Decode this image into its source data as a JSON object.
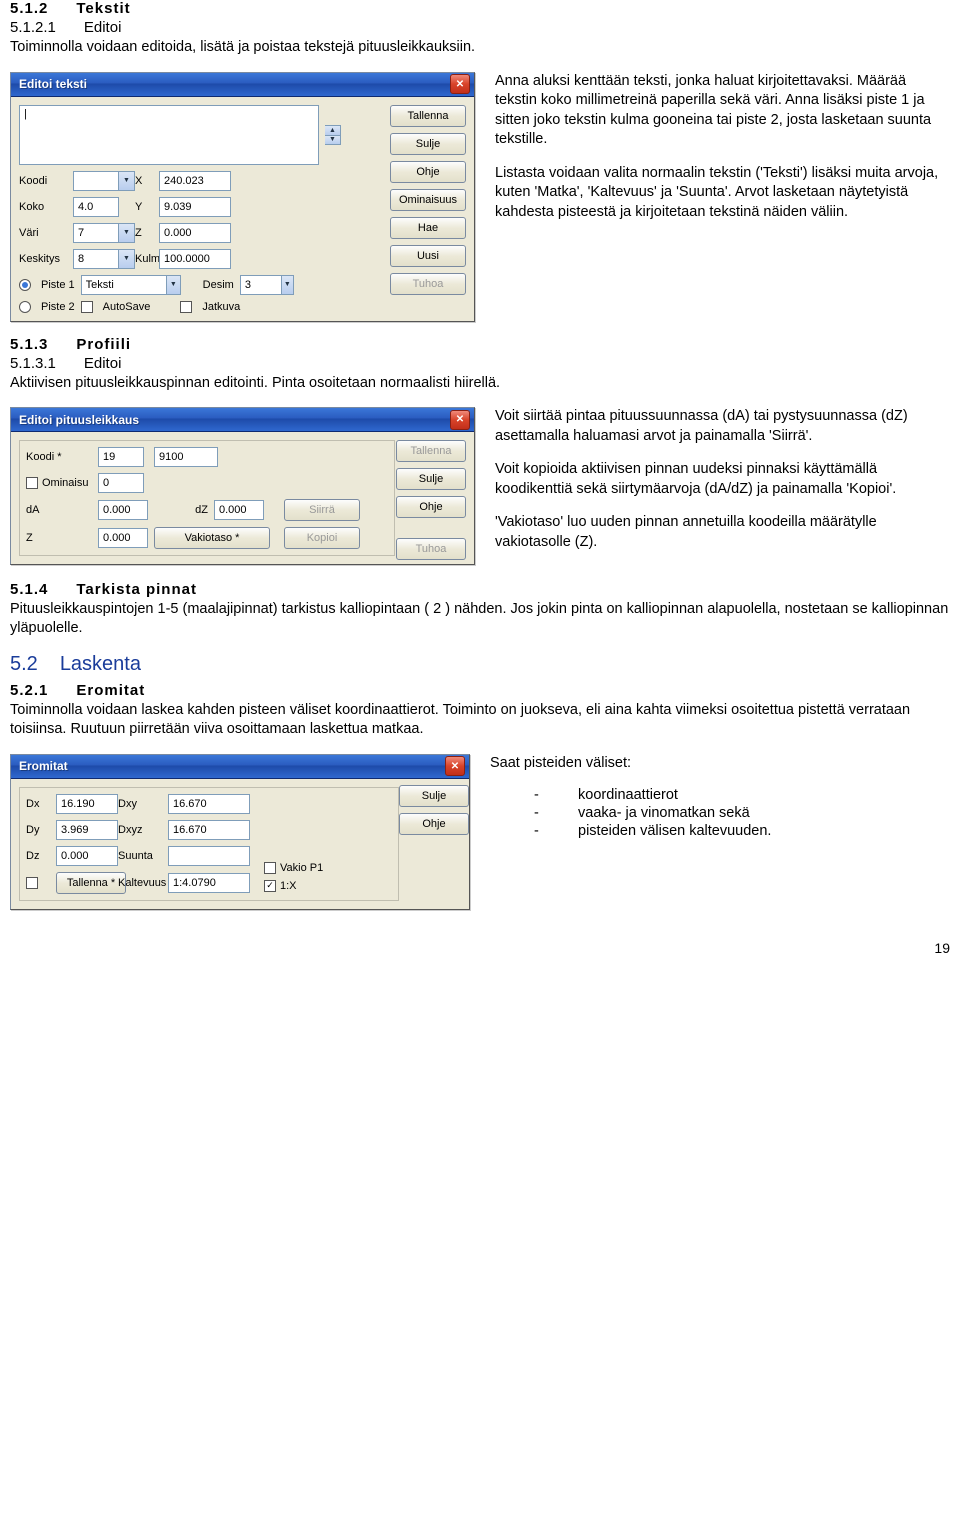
{
  "doc": {
    "s512_num": "5.1.2",
    "s512_title": "Tekstit",
    "s5121_num": "5.1.2.1",
    "s5121_title": "Editoi",
    "s5121_desc": "Toiminnolla voidaan editoida, lisätä ja poistaa tekstejä pituusleikkauksiin.",
    "s5121_p1": "Anna aluksi kenttään teksti, jonka haluat kirjoitettavaksi. Määrää tekstin koko millimetreinä paperilla sekä väri. Anna lisäksi piste 1 ja sitten joko tekstin kulma gooneina tai piste 2, josta lasketaan suunta tekstille.",
    "s5121_p2": "Listasta voidaan valita normaalin tekstin ('Teksti') lisäksi muita arvoja, kuten 'Matka', 'Kaltevuus' ja 'Suunta'. Arvot lasketaan näytetyistä kahdesta pisteestä ja kirjoitetaan tekstinä näiden väliin.",
    "s513_num": "5.1.3",
    "s513_title": "Profiili",
    "s5131_num": "5.1.3.1",
    "s5131_title": "Editoi",
    "s5131_desc": "Aktiivisen pituusleikkauspinnan editointi. Pinta osoitetaan normaalisti hiirellä.",
    "s5131_p1": "Voit siirtää pintaa pituussuunnassa (dA) tai pystysuunnassa (dZ) asettamalla haluamasi arvot ja painamalla 'Siirrä'.",
    "s5131_p2": "Voit kopioida aktiivisen pinnan uudeksi pinnaksi käyttämällä koodikenttiä sekä siirtymäarvoja (dA/dZ) ja painamalla 'Kopioi'.",
    "s5131_p3": "'Vakiotaso' luo uuden pinnan annetuilla koodeilla määrätylle vakiotasolle (Z).",
    "s514_num": "5.1.4",
    "s514_title": "Tarkista pinnat",
    "s514_desc": "Pituusleikkauspintojen 1-5 (maalajipinnat) tarkistus kalliopintaan ( 2 ) nähden. Jos jokin pinta on kalliopinnan alapuolella, nostetaan se kalliopinnan yläpuolelle.",
    "s52_num": "5.2",
    "s52_title": "Laskenta",
    "s521_num": "5.2.1",
    "s521_title": "Eromitat",
    "s521_desc": "Toiminnolla voidaan laskea kahden pisteen väliset koordinaattierot. Toiminto on juokseva, eli aina kahta viimeksi osoitettua pistettä verrataan toisiinsa. Ruutuun piirretään viiva osoittamaan laskettua matkaa.",
    "s521_p1": "Saat pisteiden väliset:",
    "s521_li1": "koordinaattierot",
    "s521_li2": "vaaka- ja vinomatkan sekä",
    "s521_li3": "pisteiden välisen kaltevuuden.",
    "page": "19"
  },
  "dlg1": {
    "title": "Editoi teksti",
    "text_value": "|",
    "l_koodi": "Koodi",
    "v_koodi": "",
    "l_koko": "Koko",
    "v_koko": "4.0",
    "l_vari": "Väri",
    "v_vari": "7",
    "l_keskitys": "Keskitys",
    "v_keskitys": "8",
    "l_x": "X",
    "v_x": "240.023",
    "l_y": "Y",
    "v_y": "9.039",
    "l_z": "Z",
    "v_z": "0.000",
    "l_kulma": "Kulma",
    "v_kulma": "100.0000",
    "l_desim": "Desim",
    "v_desim": "3",
    "r_p1": "Piste 1",
    "r_p2": "Piste 2",
    "combo_teksti": "Teksti",
    "chk_autosave": "AutoSave",
    "chk_jatkuva": "Jatkuva",
    "btn_tallenna": "Tallenna",
    "btn_sulje": "Sulje",
    "btn_ohje": "Ohje",
    "btn_ominaisuus": "Ominaisuus",
    "btn_hae": "Hae",
    "btn_uusi": "Uusi",
    "btn_tuhoa": "Tuhoa"
  },
  "dlg2": {
    "title": "Editoi pituusleikkaus",
    "l_koodi": "Koodi *",
    "v_koodi1": "19",
    "v_koodi2": "9100",
    "l_ominaisu": "Ominaisu",
    "v_ominaisu": "0",
    "l_da": "dA",
    "v_da": "0.000",
    "l_dz": "dZ",
    "v_dz": "0.000",
    "l_z": "Z",
    "v_z": "0.000",
    "btn_vakiotaso": "Vakiotaso *",
    "btn_siirra": "Siirrä",
    "btn_kopioi": "Kopioi",
    "btn_tallenna": "Tallenna",
    "btn_sulje": "Sulje",
    "btn_ohje": "Ohje",
    "btn_tuhoa": "Tuhoa"
  },
  "dlg3": {
    "title": "Eromitat",
    "l_dx": "Dx",
    "v_dx": "16.190",
    "l_dy": "Dy",
    "v_dy": "3.969",
    "l_dz": "Dz",
    "v_dz": "0.000",
    "l_dxy": "Dxy",
    "v_dxy": "16.670",
    "l_dxyz": "Dxyz",
    "v_dxyz": "16.670",
    "l_suunta": "Suunta",
    "v_suunta": "",
    "l_kaltevuus": "Kaltevuus",
    "v_kaltevuus": "1:4.0790",
    "btn_tallenna": "Tallenna *",
    "btn_sulje": "Sulje",
    "btn_ohje": "Ohje",
    "chk_vakiop1": "Vakio P1",
    "chk_1x": "1:X"
  }
}
